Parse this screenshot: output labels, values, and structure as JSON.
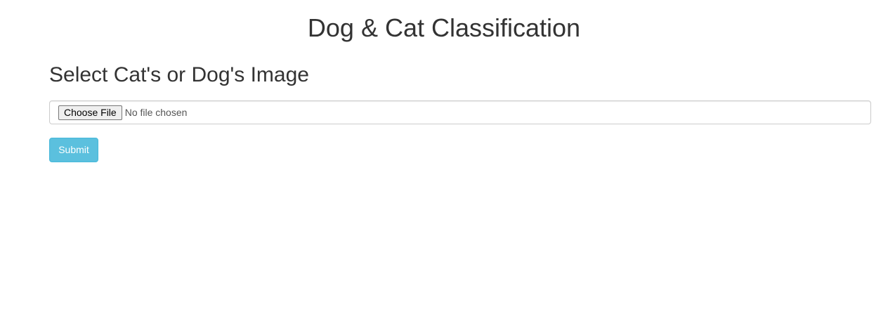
{
  "page": {
    "title": "Dog & Cat Classification"
  },
  "form": {
    "heading": "Select Cat's or Dog's Image",
    "file_input": {
      "button_label": "Choose File",
      "status": "No file chosen"
    },
    "submit_label": "Submit"
  },
  "colors": {
    "submit_background": "#5bc0de",
    "submit_border": "#46b8da",
    "text": "#333333"
  }
}
